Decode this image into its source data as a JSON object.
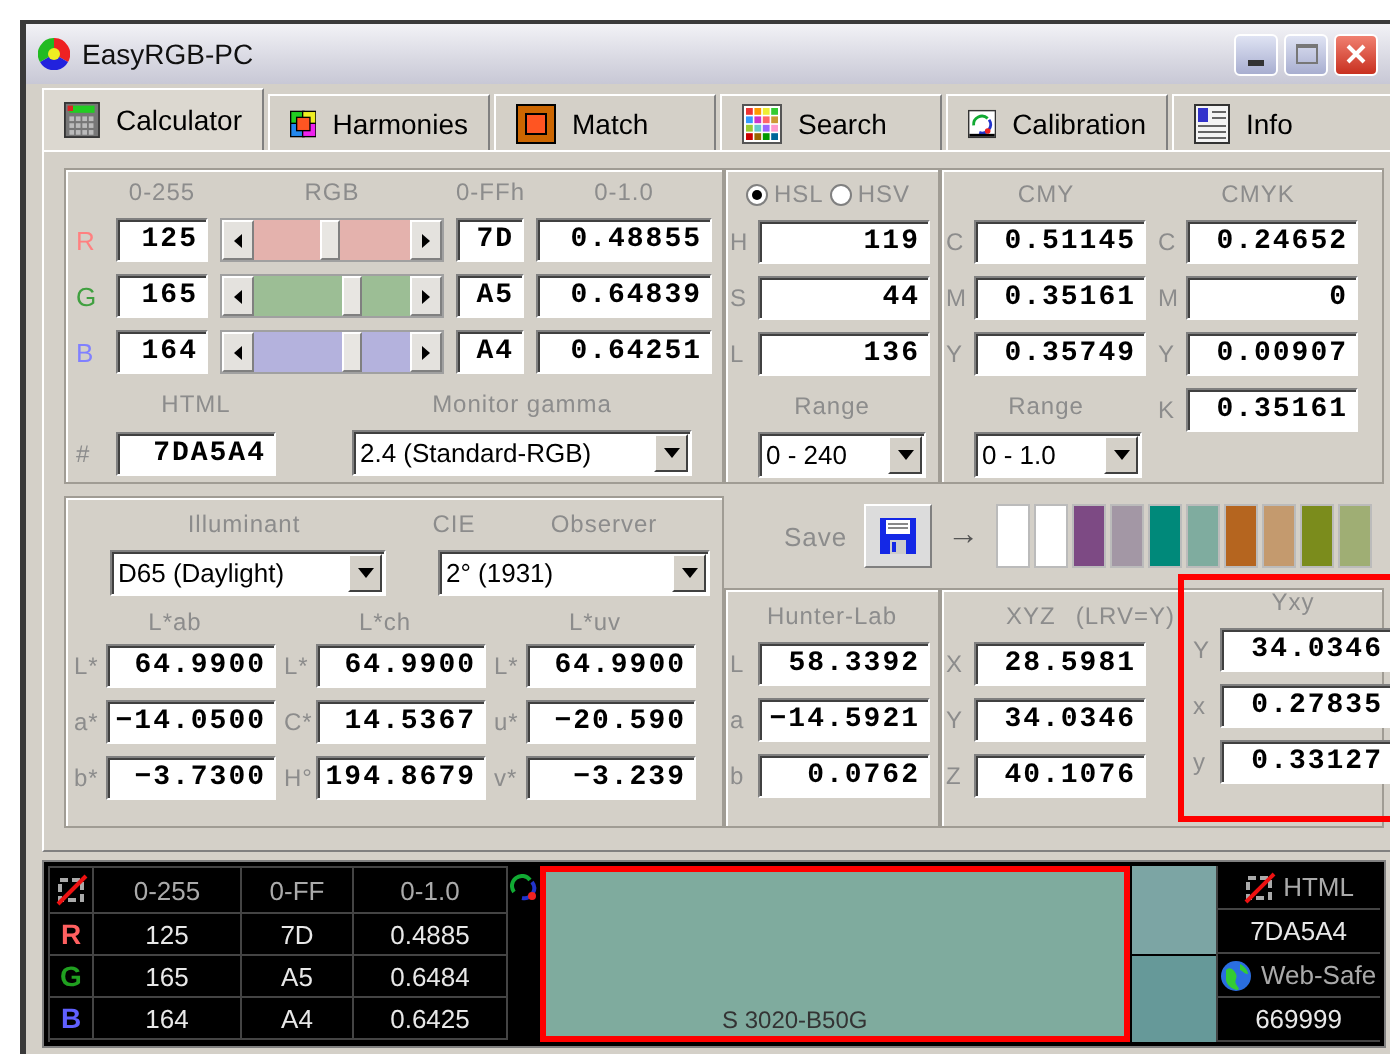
{
  "window": {
    "title": "EasyRGB-PC"
  },
  "tabs": [
    {
      "label": "Calculator",
      "selected": true
    },
    {
      "label": "Harmonies",
      "selected": false
    },
    {
      "label": "Match",
      "selected": false
    },
    {
      "label": "Search",
      "selected": false
    },
    {
      "label": "Calibration",
      "selected": false
    },
    {
      "label": "Info",
      "selected": false
    }
  ],
  "rgb": {
    "headers": [
      "0-255",
      "RGB",
      "0-FFh",
      "0-1.0"
    ],
    "channels": [
      {
        "label": "R",
        "color": "#ff8080",
        "value": "125",
        "level": 0.49,
        "hex": "7D",
        "unit": "0.48855"
      },
      {
        "label": "G",
        "color": "#40a040",
        "value": "165",
        "level": 0.65,
        "hex": "A5",
        "unit": "0.64839"
      },
      {
        "label": "B",
        "color": "#8080ff",
        "value": "164",
        "level": 0.64,
        "hex": "A4",
        "unit": "0.64251"
      }
    ],
    "html_label": "HTML",
    "hash": "#",
    "html_value": "7DA5A4",
    "gamma_label": "Monitor gamma",
    "gamma": "2.4 (Standard-RGB)"
  },
  "hsl": {
    "modes": [
      {
        "label": "HSL",
        "selected": true
      },
      {
        "label": "HSV",
        "selected": false
      }
    ],
    "rows": [
      {
        "label": "H",
        "value": "119"
      },
      {
        "label": "S",
        "value": "44"
      },
      {
        "label": "L",
        "value": "136"
      }
    ],
    "range_label": "Range",
    "range": "0 - 240"
  },
  "cmy": {
    "title": "CMY",
    "rows": [
      {
        "label": "C",
        "value": "0.51145"
      },
      {
        "label": "M",
        "value": "0.35161"
      },
      {
        "label": "Y",
        "value": "0.35749"
      }
    ],
    "range_label": "Range",
    "range": "0 - 1.0"
  },
  "cmyk": {
    "title": "CMYK",
    "rows": [
      {
        "label": "C",
        "value": "0.24652"
      },
      {
        "label": "M",
        "value": "0"
      },
      {
        "label": "Y",
        "value": "0.00907"
      },
      {
        "label": "K",
        "value": "0.35161"
      }
    ]
  },
  "cie": {
    "illuminant_label": "Illuminant",
    "cie_label": "CIE",
    "observer_label": "Observer",
    "illuminant": "D65 (Daylight)",
    "observer": "2° (1931)",
    "groups": [
      {
        "title": "L*ab",
        "rows": [
          {
            "label": "L*",
            "value": "64.9900"
          },
          {
            "label": "a*",
            "value": "−14.0500"
          },
          {
            "label": "b*",
            "value": "−3.7300"
          }
        ]
      },
      {
        "title": "L*ch",
        "rows": [
          {
            "label": "L*",
            "value": "64.9900"
          },
          {
            "label": "C*",
            "value": "14.5367"
          },
          {
            "label": "H°",
            "value": "194.8679"
          }
        ]
      },
      {
        "title": "L*uv",
        "rows": [
          {
            "label": "L*",
            "value": "64.9900"
          },
          {
            "label": "u*",
            "value": "−20.590"
          },
          {
            "label": "v*",
            "value": "−3.239"
          }
        ]
      }
    ]
  },
  "save": {
    "label": "Save",
    "arrow": "→",
    "swatches": [
      {
        "color": "#ffffff"
      },
      {
        "color": "#ffffff"
      },
      {
        "color": "#7d4a84"
      },
      {
        "color": "#a397a5"
      },
      {
        "color": "#00897a"
      },
      {
        "color": "#7fac9f"
      },
      {
        "color": "#b5651f"
      },
      {
        "color": "#c49a6e"
      },
      {
        "color": "#7b8c1c"
      },
      {
        "color": "#9fae74"
      }
    ]
  },
  "hunter": {
    "title": "Hunter-Lab",
    "rows": [
      {
        "label": "L",
        "value": "58.3392"
      },
      {
        "label": "a",
        "value": "−14.5921"
      },
      {
        "label": "b",
        "value": "0.0762"
      }
    ]
  },
  "xyz": {
    "title": "XYZ",
    "note": "(LRV=Y)",
    "rows": [
      {
        "label": "X",
        "value": "28.5981"
      },
      {
        "label": "Y",
        "value": "34.0346"
      },
      {
        "label": "Z",
        "value": "40.1076"
      }
    ]
  },
  "yxy": {
    "title": "Yxy",
    "highlighted": true,
    "rows": [
      {
        "label": "Y",
        "value": "34.0346"
      },
      {
        "label": "x",
        "value": "0.27835"
      },
      {
        "label": "y",
        "value": "0.33127"
      }
    ]
  },
  "bottom": {
    "headers": [
      "0-255",
      "0-FF",
      "0-1.0"
    ],
    "rows": [
      {
        "label": "R",
        "color": "#ff6060",
        "values": [
          "125",
          "7D",
          "0.4885"
        ]
      },
      {
        "label": "G",
        "color": "#20a020",
        "values": [
          "165",
          "A5",
          "0.6484"
        ]
      },
      {
        "label": "B",
        "color": "#6060ff",
        "values": [
          "164",
          "A4",
          "0.6425"
        ]
      }
    ],
    "preview": {
      "color": "#7fab9e",
      "label": "S 3020-B50G",
      "highlighted": true
    },
    "side_swatches": [
      {
        "color": "#7ca5a4"
      },
      {
        "color": "#669999"
      }
    ],
    "html_label": "HTML",
    "html_value": "7DA5A4",
    "websafe_label": "Web-Safe",
    "websafe_value": "669999"
  }
}
